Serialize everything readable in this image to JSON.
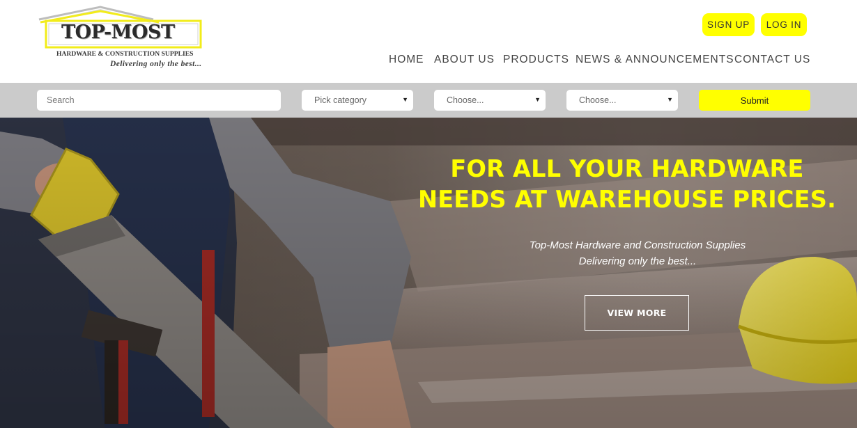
{
  "logo": {
    "title": "TOP-MOST",
    "subtitle": "HARDWARE & CONSTRUCTION SUPPLIES",
    "tagline": "Delivering only the best..."
  },
  "auth": {
    "signup_label": "SIGN UP",
    "login_label": "LOG IN"
  },
  "nav": {
    "items": [
      {
        "label": "HOME"
      },
      {
        "label": "ABOUT US"
      },
      {
        "label": "PRODUCTS"
      },
      {
        "label": "NEWS & ANNOUNCEMENTS"
      },
      {
        "label": "CONTACT US"
      }
    ]
  },
  "search": {
    "placeholder": "Search",
    "category_select": "Pick category",
    "select_2": "Choose...",
    "select_3": "Choose...",
    "submit_label": "Submit"
  },
  "hero": {
    "headline_line1": "FOR ALL YOUR HARDWARE",
    "headline_line2": "NEEDS AT WAREHOUSE PRICES.",
    "sub_line1": "Top-Most Hardware and Construction Supplies",
    "sub_line2": "Delivering only the best...",
    "cta_label": "VIEW MORE"
  },
  "colors": {
    "accent": "#ffff00",
    "searchbar_bg": "#cbcbcb",
    "nav_text": "#444444"
  },
  "icons": [
    "dropdown-caret-icon",
    "roof-icon"
  ]
}
